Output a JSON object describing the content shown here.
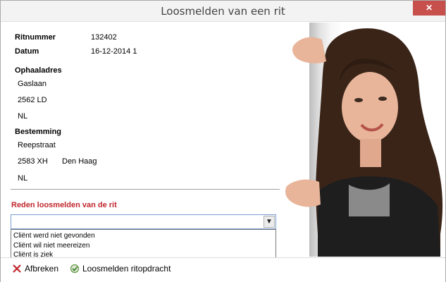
{
  "window": {
    "title": "Loosmelden van een rit",
    "close_label": "✕"
  },
  "ride": {
    "ritnummer_label": "Ritnummer",
    "ritnummer_value": "132402",
    "datum_label": "Datum",
    "datum_value": "16-12-2014 1"
  },
  "pickup": {
    "heading": "Ophaaladres",
    "street": "Gaslaan",
    "postcode": "2562 LD",
    "country": "NL"
  },
  "destination": {
    "heading": "Bestemming",
    "street": "Reepstraat",
    "postcode": "2583 XH",
    "city": "Den Haag",
    "country": "NL"
  },
  "reason": {
    "label": "Reden loosmelden van de rit",
    "selected": "",
    "options": [
      "Cliënt werd niet gevonden",
      "Cliënt wil niet meereizen",
      "Cliënt is ziek"
    ]
  },
  "footer": {
    "cancel_label": "Afbreken",
    "confirm_label": "Loosmelden ritopdracht"
  },
  "colors": {
    "accent_red": "#c1272d",
    "close_red": "#c7504c",
    "combo_border": "#7a9cd3"
  }
}
